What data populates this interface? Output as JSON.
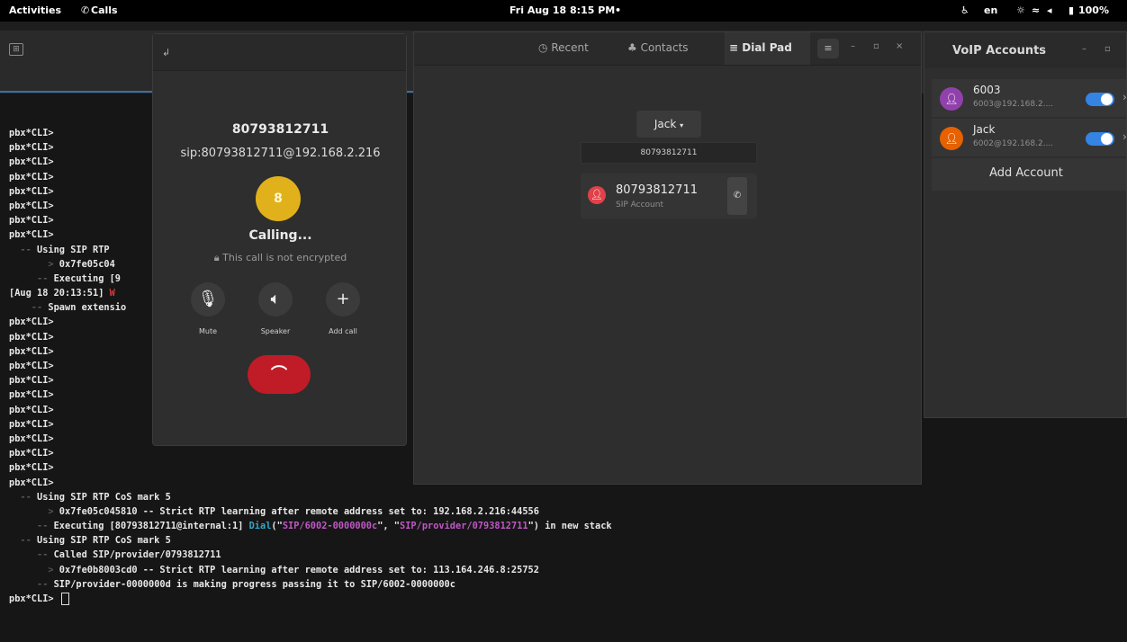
{
  "topbar": {
    "activities": "Activities",
    "app": "Calls",
    "app_icon": "handset-icon",
    "clock": "Fri Aug 18  8:15 PM",
    "dot": "•",
    "lang": "en",
    "battery": "100%"
  },
  "terminal": {
    "lines": [
      {
        "ind": "",
        "t": "pbx*CLI>"
      },
      {
        "ind": "",
        "t": "pbx*CLI>"
      },
      {
        "ind": "",
        "t": "pbx*CLI>"
      },
      {
        "ind": "",
        "t": "pbx*CLI>"
      },
      {
        "ind": "",
        "t": "pbx*CLI>"
      },
      {
        "ind": "",
        "t": "pbx*CLI>"
      },
      {
        "ind": "",
        "t": "pbx*CLI>"
      },
      {
        "ind": "",
        "t": "pbx*CLI>"
      },
      {
        "ind": "  -- ",
        "t": "Using SIP RTP"
      },
      {
        "ind": "       > ",
        "t": "0x7fe05c04"
      },
      {
        "ind": "     -- ",
        "t": "Executing [9"
      },
      {
        "ind": "",
        "t": "[Aug 18 20:13:51] ",
        "red": "W"
      },
      {
        "ind": "    -- ",
        "t": "Spawn extensio"
      },
      {
        "ind": "",
        "t": "pbx*CLI>"
      },
      {
        "ind": "",
        "t": "pbx*CLI>"
      },
      {
        "ind": "",
        "t": "pbx*CLI>"
      },
      {
        "ind": "",
        "t": "pbx*CLI>"
      },
      {
        "ind": "",
        "t": "pbx*CLI>"
      },
      {
        "ind": "",
        "t": "pbx*CLI>"
      },
      {
        "ind": "",
        "t": "pbx*CLI>"
      },
      {
        "ind": "",
        "t": "pbx*CLI>"
      },
      {
        "ind": "",
        "t": "pbx*CLI>"
      },
      {
        "ind": "",
        "t": "pbx*CLI>"
      },
      {
        "ind": "",
        "t": "pbx*CLI>"
      },
      {
        "ind": "",
        "t": "pbx*CLI>"
      },
      {
        "ind": "  -- ",
        "t": "Using SIP RTP CoS mark 5"
      },
      {
        "ind": "       > ",
        "t": "0x7fe05c045810 -- Strict RTP learning after remote address set to: 192.168.2.216:44556"
      },
      {
        "ind": "     -- ",
        "t": "Executing [80793812711@internal:1] ",
        "cyan": "Dial",
        "mid": "(\"",
        "mag": "SIP/6002-0000000c",
        "mid2": "\", \"",
        "mag2": "SIP/provider/0793812711",
        "end": "\") in new stack"
      },
      {
        "ind": "  -- ",
        "t": "Using SIP RTP CoS mark 5"
      },
      {
        "ind": "     -- ",
        "t": "Called SIP/provider/0793812711"
      },
      {
        "ind": "       > ",
        "t": "0x7fe0b8003cd0 -- Strict RTP learning after remote address set to: 113.164.246.8:25752"
      },
      {
        "ind": "     -- ",
        "t": "SIP/provider-0000000d is making progress passing it to SIP/6002-0000000c"
      },
      {
        "ind": "",
        "t": "pbx*CLI> ",
        "cursor": true
      }
    ]
  },
  "call": {
    "number": "80793812711",
    "sip": "sip:80793812711@192.168.2.216",
    "avatar_letter": "8",
    "status": "Calling...",
    "encryption": "This call is not encrypted",
    "mute_label": "Mute",
    "speaker_label": "Speaker",
    "add_call_label": "Add call"
  },
  "main": {
    "tabs": [
      {
        "icon": "clock-icon",
        "glyph": "◷",
        "label": "Recent"
      },
      {
        "icon": "contacts-icon",
        "glyph": "♣",
        "label": "Contacts"
      },
      {
        "icon": "dialpad-icon",
        "glyph": "≡",
        "label": "Dial Pad"
      }
    ],
    "account_selector": "Jack",
    "number_value": "80793812711",
    "contact_number": "80793812711",
    "contact_type": "SIP Account"
  },
  "voip": {
    "title": "VoIP Accounts",
    "accounts": [
      {
        "name": "6003",
        "address": "6003@192.168.2....",
        "color": "#9141ac",
        "enabled": true
      },
      {
        "name": "Jack",
        "address": "6002@192.168.2....",
        "color": "#e66100",
        "enabled": true
      }
    ],
    "add_label": "Add Account"
  }
}
